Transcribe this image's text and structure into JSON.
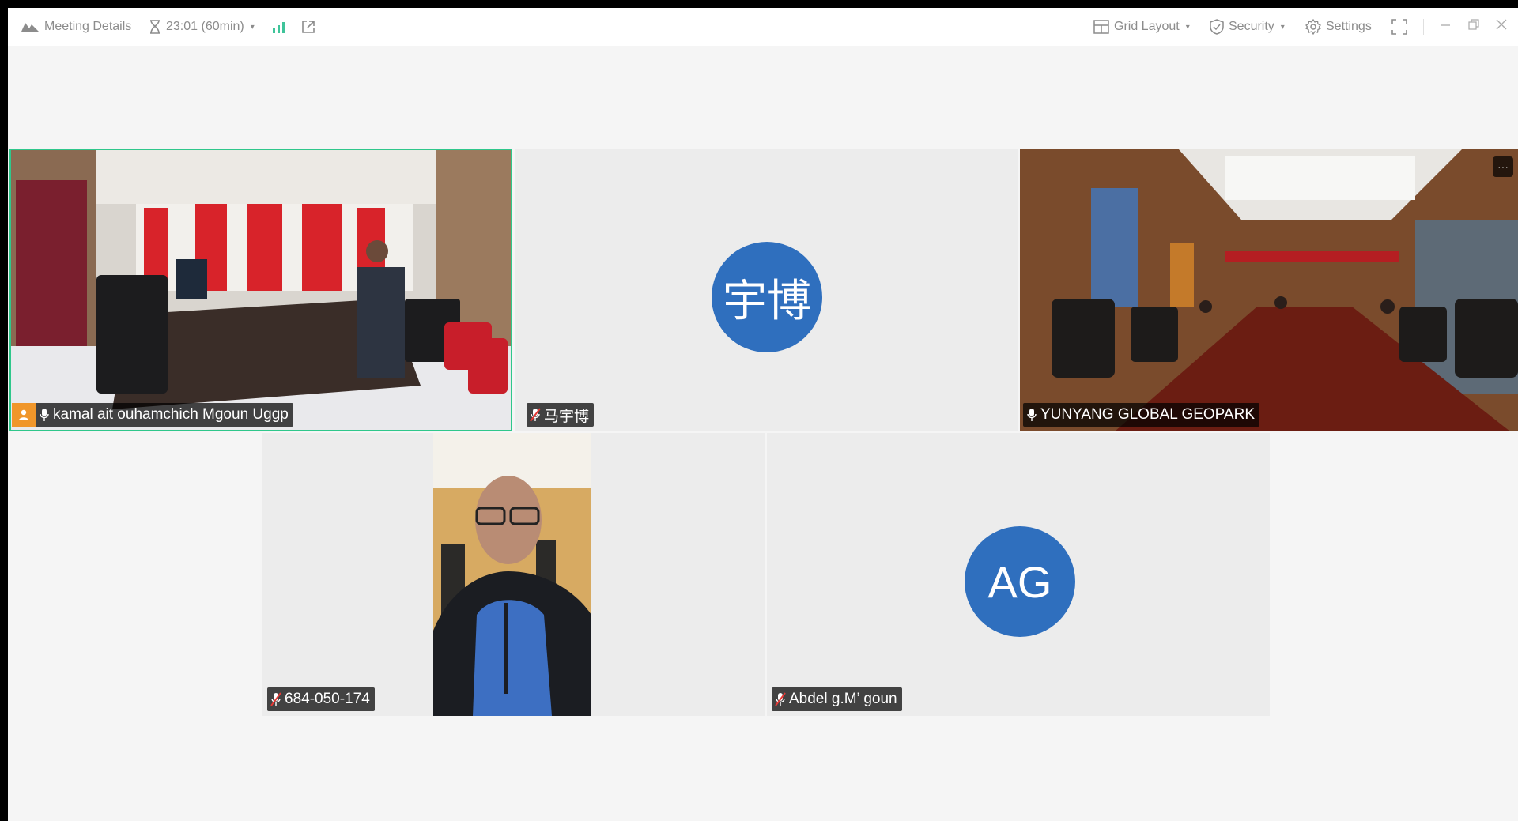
{
  "topbar": {
    "meeting_details": "Meeting Details",
    "timer": "23:01 (60min)",
    "grid_layout": "Grid Layout",
    "security": "Security",
    "settings": "Settings"
  },
  "participants": {
    "p1": {
      "name": "kamal ait ouhamchich Mgoun Uggp",
      "mic": "on",
      "host": true
    },
    "p2": {
      "name": "马宇博",
      "avatar": "宇博",
      "mic": "muted"
    },
    "p3": {
      "name": "YUNYANG GLOBAL GEOPARK",
      "mic": "on",
      "more": "···"
    },
    "p4": {
      "name": "684-050-174",
      "mic": "muted"
    },
    "p5": {
      "name": "Abdel g.M’  goun",
      "avatar": "AG",
      "mic": "muted"
    }
  },
  "colors": {
    "active_speaker_border": "#2fc78b",
    "avatar_bg": "#2f6fbe",
    "host_badge": "#f0962a",
    "name_tag_bg": "#000000b8"
  },
  "icons": [
    "meeting-logo-icon",
    "hourglass-icon",
    "signal-bars-icon",
    "share-out-icon",
    "grid-icon",
    "shield-icon",
    "gear-icon",
    "fullscreen-icon",
    "minimize-icon",
    "restore-icon",
    "close-icon",
    "mic-icon",
    "mic-muted-icon",
    "host-person-icon",
    "more-icon"
  ]
}
